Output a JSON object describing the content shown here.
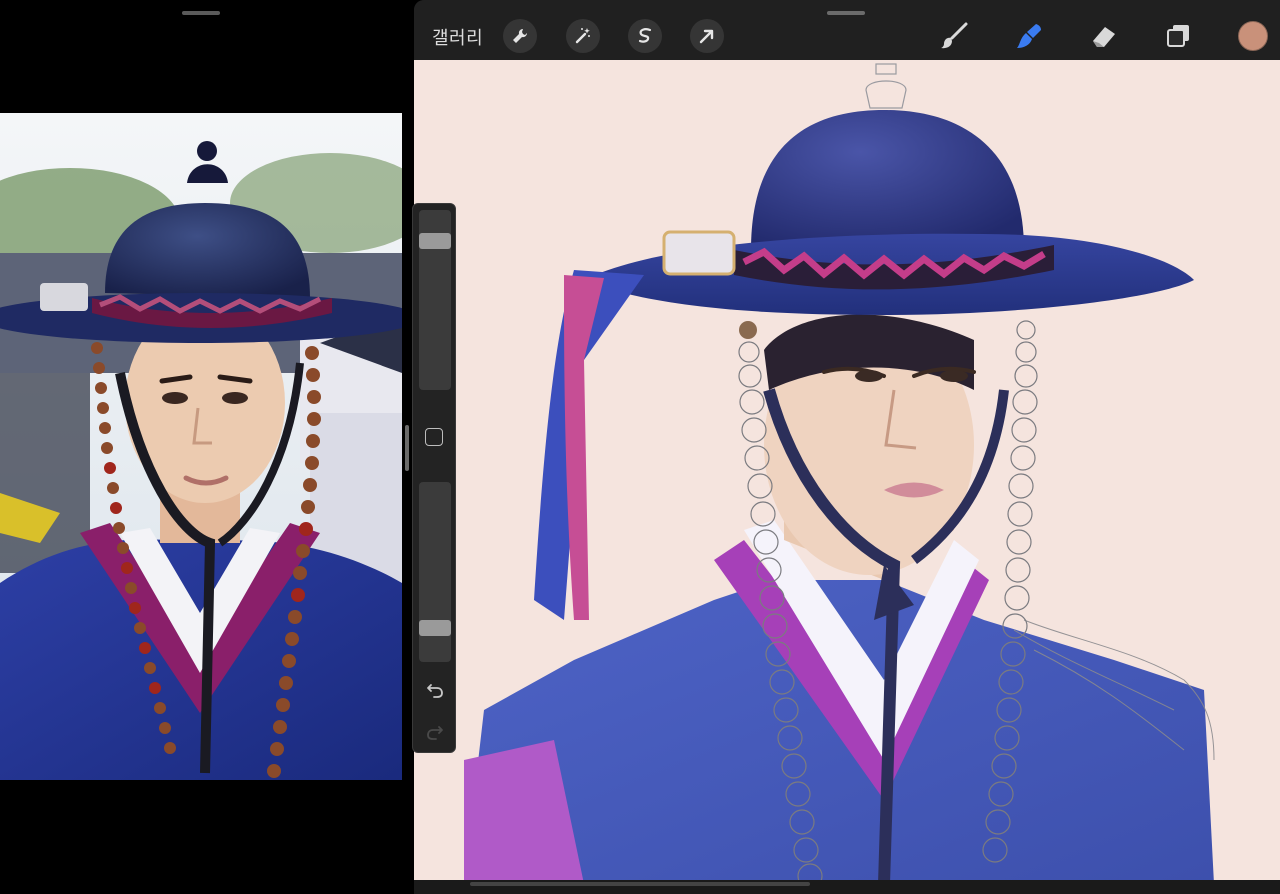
{
  "toolbar": {
    "gallery_label": "갤러리",
    "color_swatch_hex": "#c9917a",
    "active_tool": "smudge",
    "icons": [
      "wrench-icon",
      "magic-wand-icon",
      "selection-s-icon",
      "transform-arrow-icon",
      "brush-icon",
      "smudge-icon",
      "eraser-icon",
      "layers-icon"
    ]
  },
  "sidebar": {
    "brush_size_level": 0.12,
    "opacity_level": 0.86,
    "icons": [
      "modify-square-icon",
      "undo-icon",
      "redo-icon"
    ]
  },
  "colors": {
    "canvas_background": "#f5e4de",
    "toolbar_background": "#202020",
    "active_tool": "#3a7bf0"
  }
}
